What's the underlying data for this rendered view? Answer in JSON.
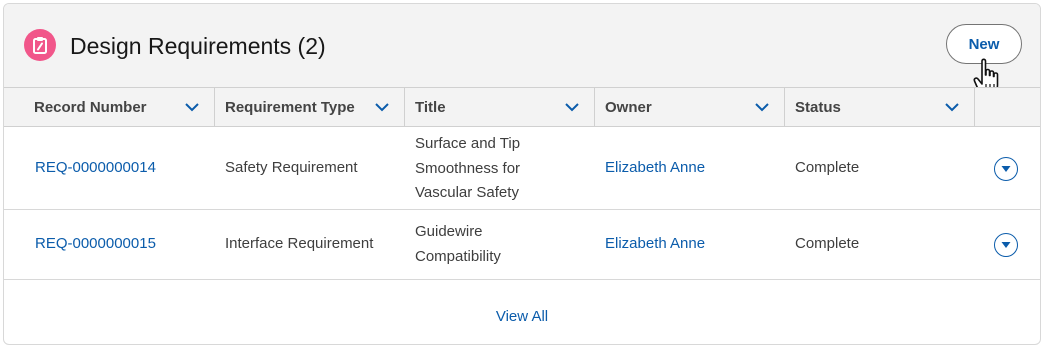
{
  "card": {
    "title": "Design Requirements (2)",
    "new_label": "New",
    "icon": "clipboard-icon",
    "icon_color": "#f1568a",
    "accent_color": "#0b5cab"
  },
  "table": {
    "columns": [
      {
        "label": "Record Number"
      },
      {
        "label": "Requirement Type"
      },
      {
        "label": "Title"
      },
      {
        "label": "Owner"
      },
      {
        "label": "Status"
      }
    ],
    "rows": [
      {
        "record_number": "REQ-0000000014",
        "type": "Safety Requirement",
        "title_lines": [
          "Surface and Tip",
          "Smoothness for",
          "Vascular Safety"
        ],
        "owner": "Elizabeth Anne",
        "status": "Complete"
      },
      {
        "record_number": "REQ-0000000015",
        "type": "Interface Requirement",
        "title_lines": [
          "Guidewire",
          "Compatibility"
        ],
        "owner": "Elizabeth Anne",
        "status": "Complete"
      }
    ]
  },
  "footer": {
    "view_all_label": "View All"
  }
}
